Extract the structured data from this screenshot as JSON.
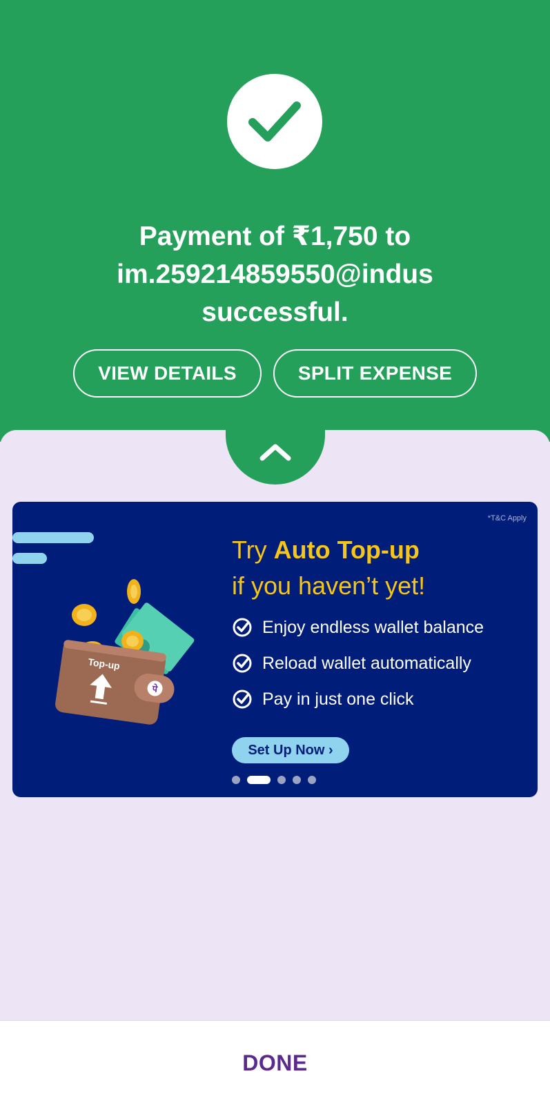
{
  "payment": {
    "message_line1": "Payment of ₹1,750 to",
    "message_line2": "im.259214859550@indus",
    "message_line3": "successful."
  },
  "actions": {
    "view_details": "VIEW DETAILS",
    "split_expense": "SPLIT EXPENSE"
  },
  "banner": {
    "tc": "*T&C Apply",
    "headline_prefix": "Try ",
    "headline_bold": "Auto Top-up",
    "headline_line2": "if you haven’t yet!",
    "features": [
      "Enjoy endless wallet balance",
      "Reload wallet automatically",
      "Pay in just one click"
    ],
    "cta": "Set Up Now ›",
    "wallet_label": "Top-up",
    "carousel_total": 5,
    "carousel_active": 2
  },
  "footer": {
    "done": "DONE"
  },
  "colors": {
    "success_green": "#24a05a",
    "banner_navy": "#001d7a",
    "accent_yellow": "#f6c519",
    "done_purple": "#5b2a8e",
    "sheet_lavender": "#ede4f5"
  },
  "icons": [
    "check-icon",
    "chevron-up-icon",
    "wallet-illustration",
    "check-circle-icon"
  ]
}
